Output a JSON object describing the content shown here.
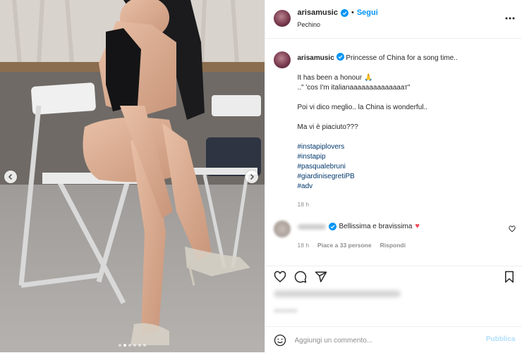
{
  "post": {
    "username": "arisamusic",
    "follow_label": "Segui",
    "location": "Pechino",
    "caption_first_line": "Princesse of China for a song time..",
    "caption_lines": [
      "It has been a honour 🙏",
      "..\" 'cos I'm italianaaaaaaaaaaaaaaт\"",
      "",
      "Poi vi dico meglio.. la China is wonderful..",
      "",
      "Ma vi è piaciuto???",
      ""
    ],
    "hashtags": [
      "#instapiplovers",
      "#instapip",
      "#pasqualebruni",
      "#giardinisegretiPB",
      "#adv"
    ],
    "caption_time": "18 h"
  },
  "comment": {
    "text": "Bellissima e bravissima",
    "time": "18 h",
    "likes_label": "Piace a 33 persone",
    "reply_label": "Rispondi"
  },
  "composer": {
    "placeholder": "Aggiungi un commento...",
    "publish_label": "Pubblica"
  },
  "icons": {
    "verified": "verified-badge-icon",
    "more": "more-options-icon",
    "like": "heart-icon",
    "comment": "comment-icon",
    "share": "share-icon",
    "save": "bookmark-icon",
    "emoji": "emoji-icon"
  },
  "colors": {
    "accent": "#0095f6",
    "verified": "#0095f6",
    "heart_red": "#ed4956"
  },
  "carousel": {
    "slides": 6,
    "active": 1
  }
}
